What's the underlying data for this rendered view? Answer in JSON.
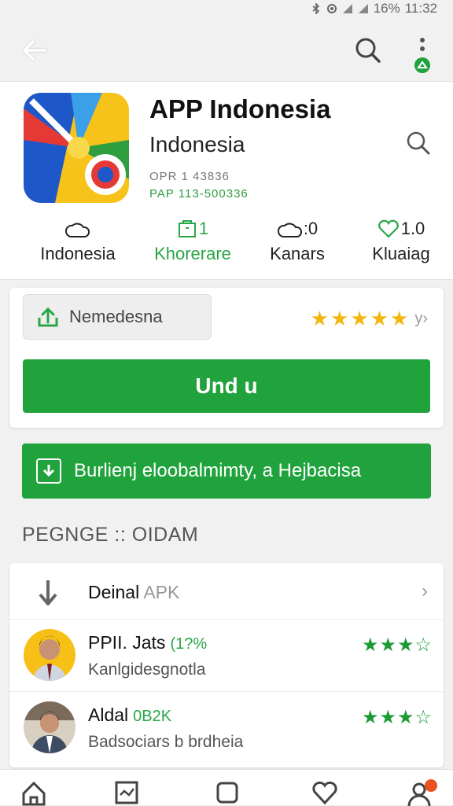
{
  "status": {
    "battery": "16%",
    "time": "11:32"
  },
  "app": {
    "name": "APP Indonesia",
    "subtitle": "Indonesia",
    "meta_line1": "OPR 1 43836",
    "meta_line2": "PAP 113-500336"
  },
  "stats": [
    {
      "value": "",
      "label": "Indonesia",
      "icon": "cloud-outline-icon"
    },
    {
      "value": "1",
      "label": "Khorerare",
      "icon": "box-icon"
    },
    {
      "value": ":0",
      "label": "Kanars",
      "icon": "cloud-outline-icon"
    },
    {
      "value": "1.0",
      "label": "Kluaiag",
      "icon": "heart-icon"
    }
  ],
  "rating_chip": {
    "label": "Nemedesna",
    "icon": "share-upload-icon"
  },
  "rating": {
    "stars": 5
  },
  "buttons": {
    "main": "Und u",
    "secondary": "Burlienj eloobalmimty, a Hejbacisa"
  },
  "section_title": "PEGNGE :: OIDAM",
  "list": {
    "download_row": {
      "title": "Deinal",
      "suffix": "APK"
    },
    "reviews": [
      {
        "name": "PPII. Jats",
        "percent": "(1?%",
        "desc": "Kanlgidesgnotla",
        "stars": "★★★☆"
      },
      {
        "name": "Aldal",
        "percent": "0B2K",
        "desc": "Badsociars b brdheia",
        "stars": "★★★☆"
      }
    ]
  },
  "colors": {
    "accent": "#20a23c",
    "star": "#f3b610"
  }
}
